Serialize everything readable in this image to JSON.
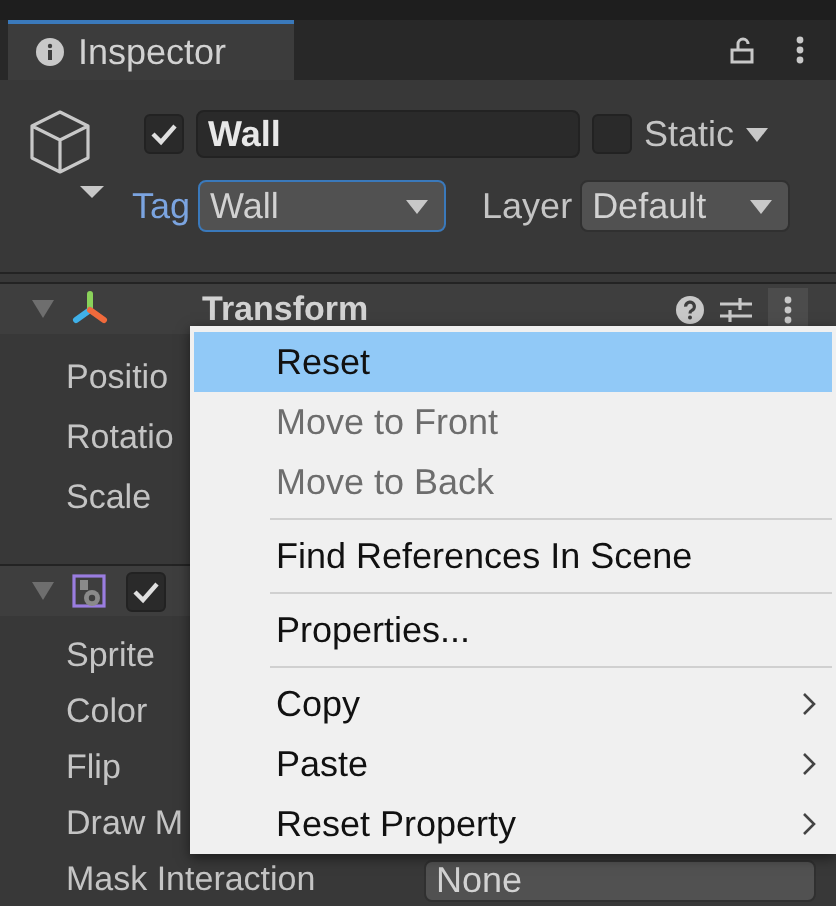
{
  "tab": {
    "title": "Inspector"
  },
  "object": {
    "active": true,
    "name": "Wall",
    "static": false,
    "static_label": "Static",
    "tag_label": "Tag",
    "tag": "Wall",
    "tag_focused": true,
    "layer_label": "Layer",
    "layer": "Default"
  },
  "components": [
    {
      "kind": "transform",
      "title": "Transform",
      "properties": [
        {
          "label": "Positio"
        },
        {
          "label": "Rotatio"
        },
        {
          "label": "Scale"
        }
      ]
    },
    {
      "kind": "sprite_renderer",
      "enabled": true,
      "properties": [
        {
          "label": "Sprite"
        },
        {
          "label": "Color"
        },
        {
          "label": "Flip"
        },
        {
          "label": "Draw M"
        },
        {
          "label": "Mask Interaction",
          "value": "None"
        }
      ]
    }
  ],
  "context_menu": {
    "items": [
      {
        "kind": "item",
        "label": "Reset",
        "selected": true,
        "disabled": false,
        "submenu": false
      },
      {
        "kind": "item",
        "label": "Move to Front",
        "selected": false,
        "disabled": true,
        "submenu": false
      },
      {
        "kind": "item",
        "label": "Move to Back",
        "selected": false,
        "disabled": true,
        "submenu": false
      },
      {
        "kind": "separator"
      },
      {
        "kind": "item",
        "label": "Find References In Scene",
        "selected": false,
        "disabled": false,
        "submenu": false
      },
      {
        "kind": "separator"
      },
      {
        "kind": "item",
        "label": "Properties...",
        "selected": false,
        "disabled": false,
        "submenu": false
      },
      {
        "kind": "separator"
      },
      {
        "kind": "item",
        "label": "Copy",
        "selected": false,
        "disabled": false,
        "submenu": true
      },
      {
        "kind": "item",
        "label": "Paste",
        "selected": false,
        "disabled": false,
        "submenu": true
      },
      {
        "kind": "item",
        "label": "Reset Property",
        "selected": false,
        "disabled": false,
        "submenu": true
      }
    ]
  }
}
